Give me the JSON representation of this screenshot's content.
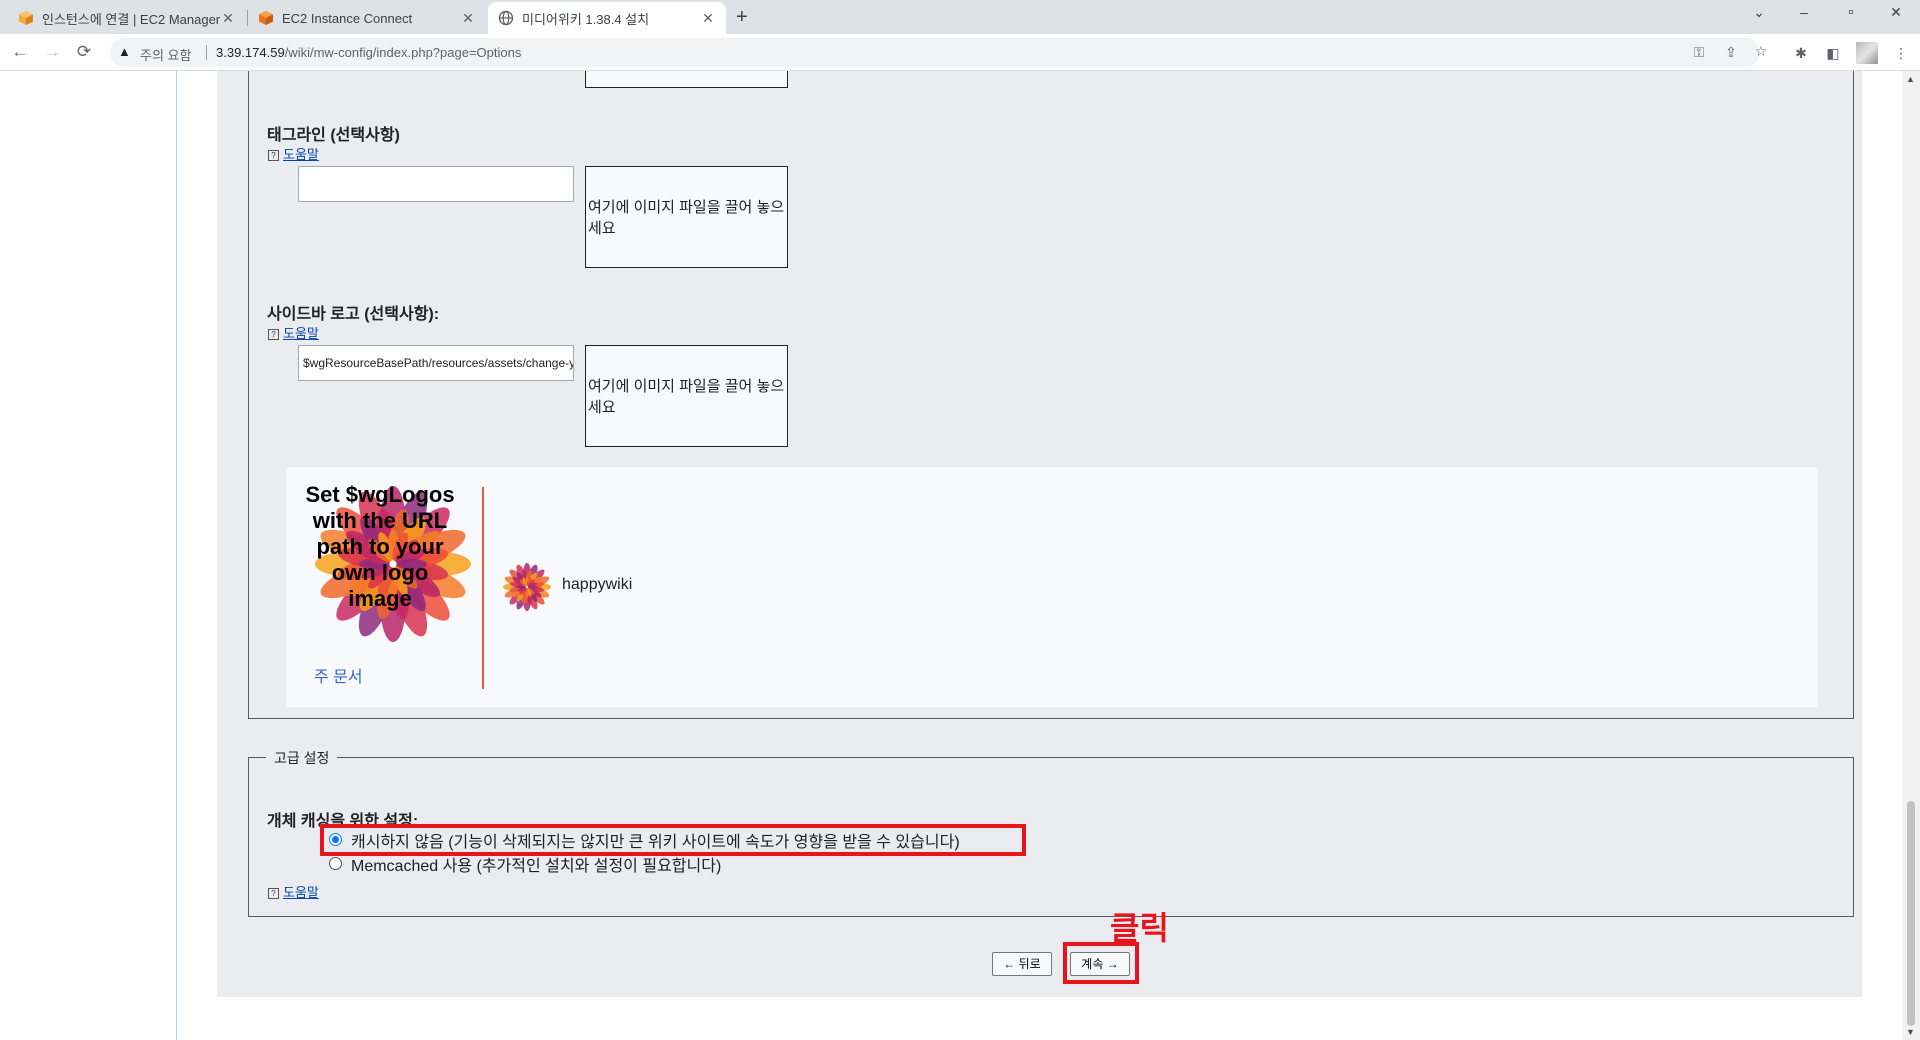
{
  "browser": {
    "tabs": [
      {
        "title": "인스턴스에 연결 | EC2 Manager",
        "favicon": "aws-cube-icon"
      },
      {
        "title": "EC2 Instance Connect",
        "favicon": "aws-cube-icon"
      },
      {
        "title": "미디어위키 1.38.4 설치",
        "favicon": "globe-icon"
      }
    ],
    "new_tab": "+",
    "window_controls": {
      "tab_search": "⌄",
      "minimize": "–",
      "maximize": "▫",
      "close": "✕"
    },
    "nav": {
      "back": "←",
      "forward": "→",
      "reload": "⟳"
    },
    "security_label": "주의 요함",
    "url_host": "3.39.174.59",
    "url_path": "/wiki/mw-config/index.php?page=Options"
  },
  "form": {
    "tagline": {
      "label": "태그라인 (선택사항)",
      "help": "도움말",
      "value": "",
      "dropzone": "여기에 이미지 파일을 끌어 놓으세요"
    },
    "sidebar_logo": {
      "label": "사이드바 로고 (선택사항):",
      "help": "도움말",
      "value": "$wgResourceBasePath/resources/assets/change-your-logo.svg",
      "dropzone": "여기에 이미지 파일을 끌어 놓으세요"
    },
    "preview": {
      "logo_text": "Set $wgLogos with the URL path to your own logo image",
      "main_page_link": "주 문서",
      "wiki_name": "happywiki"
    },
    "advanced": {
      "legend": "고급 설정",
      "caching_label": "개체 캐싱을 위한 설정:",
      "options": [
        {
          "label": "캐시하지 않음 (기능이 삭제되지는 않지만 큰 위키 사이트에 속도가 영향을 받을 수 있습니다)",
          "checked": true
        },
        {
          "label": "Memcached 사용 (추가적인 설치와 설정이 필요합니다)",
          "checked": false
        }
      ],
      "help": "도움말"
    },
    "annotation": "클릭",
    "back_button": "← 뒤로",
    "continue_button": "계속 →"
  },
  "colors": {
    "annotation_red": "#e8141c",
    "link_blue": "#0645ad",
    "radio_blue": "#0075ff"
  }
}
